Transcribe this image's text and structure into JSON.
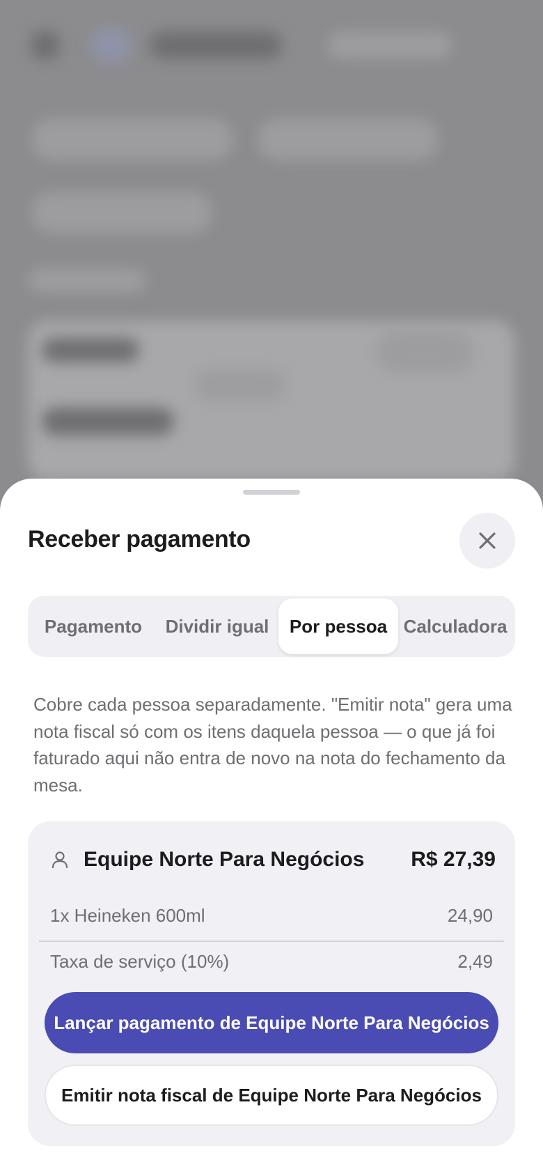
{
  "sheet": {
    "title": "Receber pagamento",
    "close_icon": "close-icon"
  },
  "tabs": [
    {
      "label": "Pagamento",
      "active": false
    },
    {
      "label": "Dividir igual",
      "active": false
    },
    {
      "label": "Por pessoa",
      "active": true
    },
    {
      "label": "Calculadora",
      "active": false
    }
  ],
  "description": "Cobre cada pessoa separadamente. \"Emitir nota\" gera uma nota fiscal só com os itens daquela pessoa — o que já foi faturado aqui não entra de novo na nota do fechamento da mesa.",
  "person_card": {
    "icon": "person-icon",
    "name": "Equipe Norte Para Negócios",
    "total": "R$ 27,39",
    "items": [
      {
        "label": "1x Heineken 600ml",
        "value": "24,90"
      },
      {
        "label": "Taxa de serviço (10%)",
        "value": "2,49"
      }
    ],
    "primary_button": "Lançar pagamento de Equipe Norte Para Negócios",
    "secondary_button": "Emitir nota fiscal de Equipe Norte Para Negócios"
  },
  "colors": {
    "accent": "#4a4bb3",
    "card_bg": "#f0f0f5",
    "overlay": "#8a8a8c"
  }
}
